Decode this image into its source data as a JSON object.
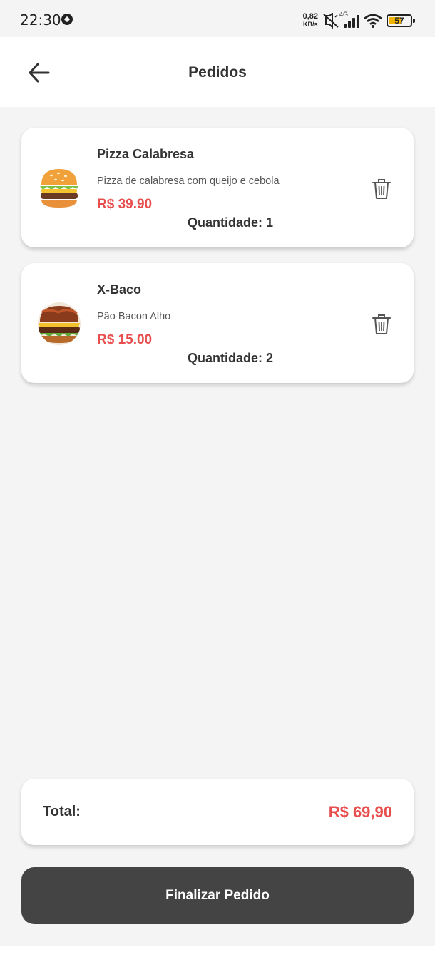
{
  "status_bar": {
    "time": "22:30",
    "net_speed_value": "0,82",
    "net_speed_unit": "KB/s",
    "network_type": "4G",
    "battery_level": "57"
  },
  "header": {
    "title": "Pedidos"
  },
  "orders": [
    {
      "name": "Pizza Calabresa",
      "description": "Pizza de calabresa com queijo e cebola",
      "price": "R$ 39.90",
      "quantity": "Quantidade: 1",
      "image": "hamburger-emoji"
    },
    {
      "name": "X-Baco",
      "description": "Pão Bacon Alho",
      "price": "R$ 15.00",
      "quantity": "Quantidade: 2",
      "image": "burger-photo"
    }
  ],
  "total": {
    "label": "Total:",
    "value": "R$ 69,90"
  },
  "finish_button": {
    "label": "Finalizar Pedido"
  },
  "colors": {
    "price": "#e84e4e",
    "button": "#444444",
    "background": "#f4f4f4"
  }
}
